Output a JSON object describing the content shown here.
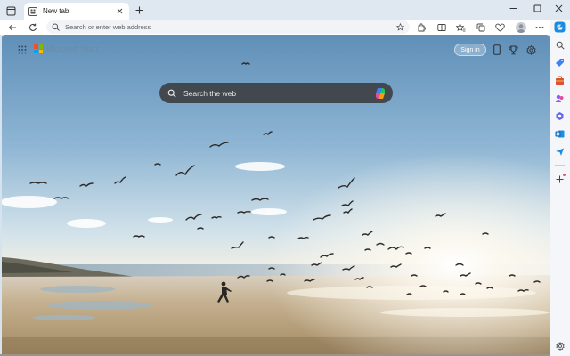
{
  "browser": {
    "tab": {
      "title": "New tab"
    },
    "address_bar": {
      "placeholder": "Search or enter web address"
    }
  },
  "newtab": {
    "brand": "Microsoft Start",
    "signin_label": "Sign in",
    "search_placeholder": "Search the web"
  },
  "colors": {
    "sky_top": "#5f8fb8",
    "sky_horizon": "#f3efe4",
    "sand": "#b49a73",
    "search_bg": "#383838",
    "edge_blue": "#1b8de0"
  },
  "icons": {
    "toolbar": [
      "back-icon",
      "refresh-icon",
      "favorite-star-icon",
      "extensions-icon",
      "split-screen-icon",
      "favorites-icon",
      "collections-icon",
      "browser-essentials-icon",
      "profile-avatar",
      "more-options-icon"
    ],
    "sidebar": [
      "copilot-icon",
      "search-icon",
      "shopping-tag-icon",
      "tools-icon",
      "games-icon",
      "microsoft-365-icon",
      "outlook-icon",
      "drop-icon",
      "add-icon",
      "settings-icon"
    ]
  }
}
